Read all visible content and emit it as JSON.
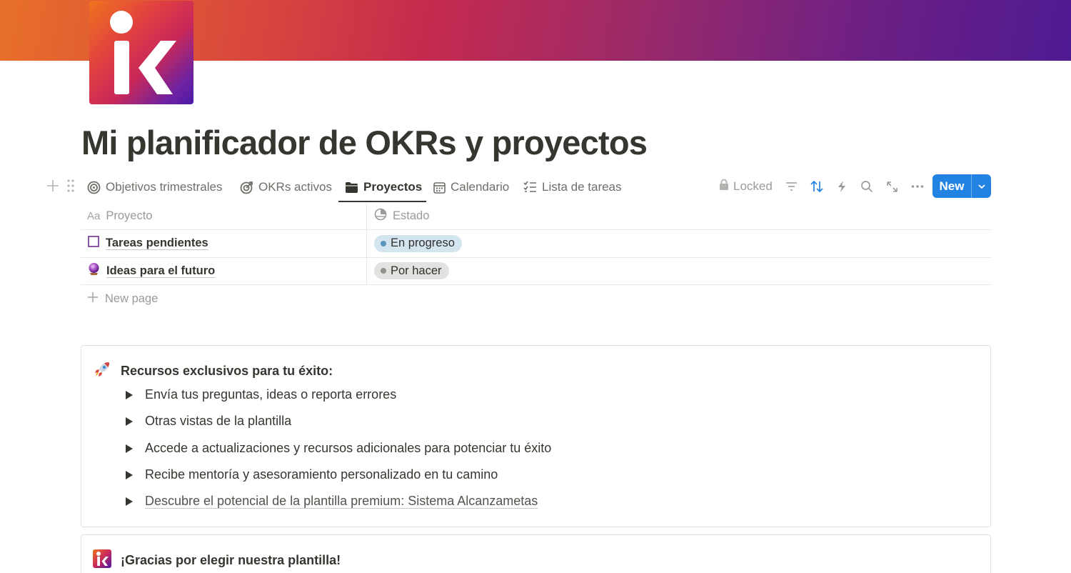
{
  "page": {
    "title": "Mi planificador de OKRs y proyectos",
    "icon": "ik-logo-icon",
    "cover_colors": [
      "#e8702a",
      "#c52a4e",
      "#4e1a92"
    ]
  },
  "views": {
    "tabs": [
      {
        "label": "Objetivos trimestrales",
        "icon": "target-circle-icon"
      },
      {
        "label": "OKRs activos",
        "icon": "bullseye-icon"
      },
      {
        "label": "Proyectos",
        "icon": "folder-icon",
        "active": true
      },
      {
        "label": "Calendario",
        "icon": "calendar-icon"
      },
      {
        "label": "Lista de tareas",
        "icon": "checklist-icon"
      }
    ]
  },
  "toolbar": {
    "locked_label": "Locked",
    "new_label": "New",
    "icons": [
      "lock-icon",
      "filter-icon",
      "sort-icon",
      "lightning-icon",
      "search-icon",
      "expand-icon",
      "more-icon",
      "chevron-down-icon"
    ],
    "accent": "#2383e2"
  },
  "table": {
    "columns": [
      {
        "label": "Proyecto",
        "prefix": "Aa"
      },
      {
        "label": "Estado",
        "icon": "status-icon"
      }
    ],
    "rows": [
      {
        "title": "Tareas pendientes",
        "icon": "square-outline-icon",
        "status": "En progreso",
        "status_bg": "#d3e5ef",
        "status_dot": "#5b97bd"
      },
      {
        "title": "Ideas para el futuro",
        "icon": "crystal-ball-icon",
        "status": "Por hacer",
        "status_bg": "#e3e2e0",
        "status_dot": "#91918e"
      }
    ],
    "new_page_label": "New page"
  },
  "callout1": {
    "icon": "rocket-icon",
    "title": "Recursos exclusivos para tu éxito:",
    "items": [
      "Envía tus preguntas, ideas o reporta errores",
      "Otras vistas de la plantilla",
      "Accede a actualizaciones y recursos adicionales para potenciar tu éxito",
      "Recibe mentoría y asesoramiento personalizado en tu camino",
      "Descubre el potencial de la plantilla premium: Sistema Alcanzametas"
    ]
  },
  "callout2": {
    "icon": "ik-logo-icon",
    "title": "¡Gracias por elegir nuestra plantilla!"
  }
}
